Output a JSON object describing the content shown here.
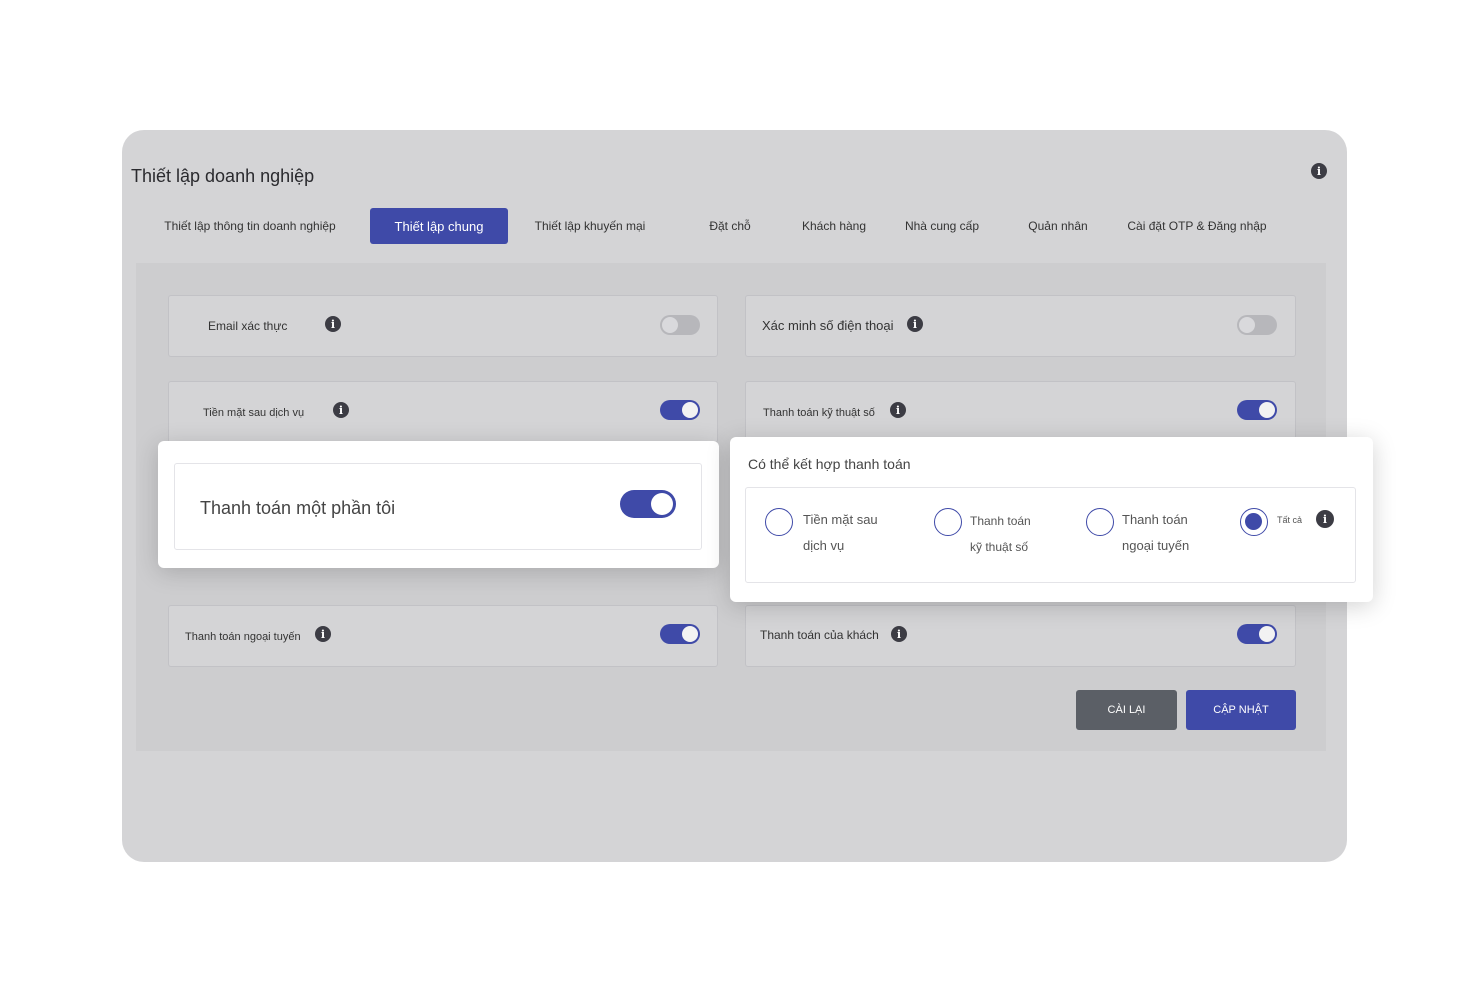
{
  "header": {
    "title": "Thiết lập doanh nghiệp",
    "info_icon": "i"
  },
  "tabs": [
    {
      "label": "Thiết lập thông tin doanh nghiệp"
    },
    {
      "label": "Thiết lập chung",
      "active": true
    },
    {
      "label": "Thiết lập khuyến mại"
    },
    {
      "label": "Đặt chỗ"
    },
    {
      "label": "Khách hàng"
    },
    {
      "label": "Nhà cung cấp"
    },
    {
      "label": "Quản nhân"
    },
    {
      "label": "Cài đặt OTP & Đăng nhập"
    }
  ],
  "settings": [
    {
      "label": "Email xác thực",
      "enabled": false
    },
    {
      "label": "Xác minh số điện thoại",
      "enabled": false
    },
    {
      "label": "Tiền mặt sau dịch vụ",
      "enabled": true
    },
    {
      "label": "Thanh toán kỹ thuật số",
      "enabled": true
    },
    {
      "label": "Thanh toán ngoại tuyến",
      "enabled": true
    },
    {
      "label": "Thanh toán của khách",
      "enabled": true
    }
  ],
  "partial_payment": {
    "label": "Thanh toán một phần tôi",
    "enabled": true
  },
  "combine_payment": {
    "title": "Có thể kết hợp thanh toán",
    "options": [
      {
        "line1": "Tiền mặt sau",
        "line2": "dịch vụ",
        "selected": false
      },
      {
        "line1": "Thanh toán",
        "line2": "kỹ thuật số",
        "selected": false
      },
      {
        "line1": "Thanh toán",
        "line2": "ngoại tuyến",
        "selected": false
      },
      {
        "line1": "Tất cả",
        "line2": "",
        "selected": true
      }
    ]
  },
  "buttons": {
    "reset": "CÀI LẠI",
    "update": "CẬP NHẬT"
  },
  "colors": {
    "accent": "#3f4aa8",
    "reset_button": "#5b5f66",
    "overlay": "#d4d4d6"
  }
}
